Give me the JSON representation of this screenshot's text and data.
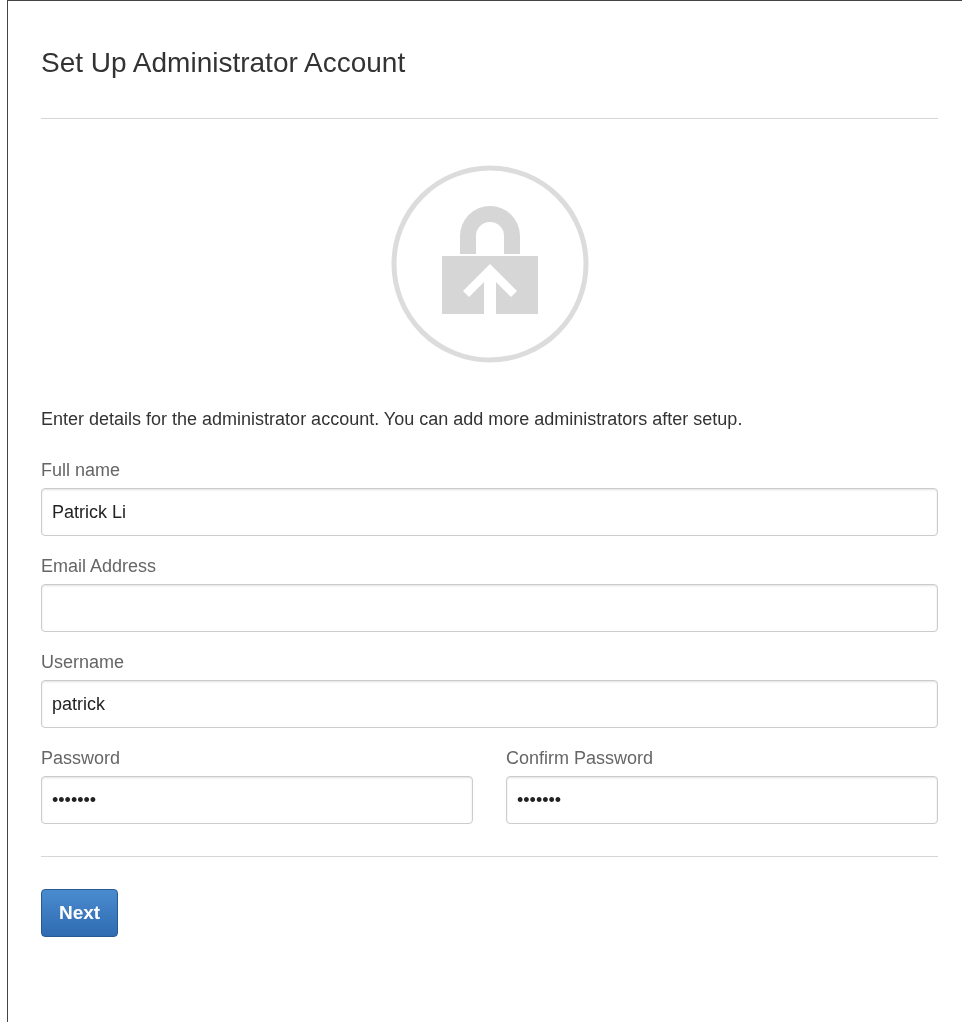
{
  "title": "Set Up Administrator Account",
  "intro": "Enter details for the administrator account. You can add more administrators after setup.",
  "fields": [
    {
      "label": "Full name",
      "value": "Patrick Li",
      "half": false
    },
    {
      "label": "Email Address",
      "half": false
    },
    {
      "label": "Username",
      "value": "patrick",
      "half": false
    },
    {
      "label": "Password",
      "value": "•••••••",
      "half": true
    },
    {
      "label": "Confirm Password",
      "value": "•••••••",
      "half": true
    }
  ],
  "buttons": [
    {
      "label": "Next",
      "primary": true
    }
  ]
}
